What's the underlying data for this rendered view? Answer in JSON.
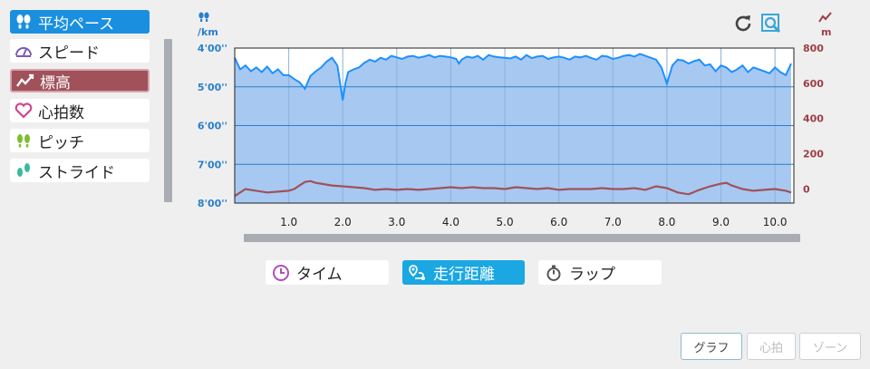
{
  "metrics": [
    {
      "label": "平均ペース",
      "icon": "footprints-icon",
      "state": "active"
    },
    {
      "label": "スピード",
      "icon": "speedometer-icon",
      "state": "normal"
    },
    {
      "label": "標高",
      "icon": "elevation-icon",
      "state": "active"
    },
    {
      "label": "心拍数",
      "icon": "heart-icon",
      "state": "normal"
    },
    {
      "label": "ピッチ",
      "icon": "pitch-icon",
      "state": "normal"
    },
    {
      "label": "ストライド",
      "icon": "stride-icon",
      "state": "normal"
    }
  ],
  "units": {
    "left": "/km",
    "right": "m"
  },
  "toolbar": {
    "reset_icon": "refresh-icon",
    "zoom_icon": "zoom-icon"
  },
  "xaxis_buttons": [
    {
      "label": "タイム",
      "icon": "clock-icon"
    },
    {
      "label": "走行距離",
      "icon": "route-icon"
    },
    {
      "label": "ラップ",
      "icon": "stopwatch-icon"
    }
  ],
  "bottom_buttons": [
    {
      "label": "グラフ",
      "enabled": true
    },
    {
      "label": "心拍",
      "enabled": false
    },
    {
      "label": "ゾーン",
      "enabled": false
    }
  ],
  "colors": {
    "pace": "#1e90ff",
    "pace_fill": "#a7c9f1",
    "elevation": "#a0515a",
    "active_tab": "#1aa7e2"
  },
  "chart_data": {
    "type": "area",
    "x_unit": "km",
    "x_ticks": [
      "1.0",
      "2.0",
      "3.0",
      "4.0",
      "5.0",
      "6.0",
      "7.0",
      "8.0",
      "9.0",
      "10.0"
    ],
    "xlim": [
      0,
      10.35
    ],
    "pace_ticks": [
      "4'00''",
      "5'00''",
      "6'00''",
      "7'00''",
      "8'00''"
    ],
    "pace_ylim_minutes": [
      4.0,
      8.0
    ],
    "elevation_ticks": [
      "800",
      "600",
      "400",
      "200",
      "0"
    ],
    "elevation_ylim": [
      -80,
      800
    ],
    "grid": true,
    "series": [
      {
        "metric": "pace",
        "x": [
          0,
          0.1,
          0.2,
          0.3,
          0.4,
          0.5,
          0.6,
          0.7,
          0.8,
          0.9,
          1.0,
          1.1,
          1.2,
          1.3,
          1.4,
          1.5,
          1.6,
          1.7,
          1.8,
          1.9,
          2.0,
          2.05,
          2.1,
          2.2,
          2.3,
          2.4,
          2.5,
          2.6,
          2.7,
          2.8,
          2.9,
          3.0,
          3.1,
          3.2,
          3.3,
          3.4,
          3.5,
          3.6,
          3.7,
          3.8,
          3.9,
          4.0,
          4.1,
          4.15,
          4.2,
          4.3,
          4.4,
          4.5,
          4.6,
          4.7,
          4.8,
          4.9,
          5.0,
          5.1,
          5.2,
          5.3,
          5.4,
          5.5,
          5.6,
          5.7,
          5.8,
          5.9,
          6.0,
          6.1,
          6.2,
          6.3,
          6.4,
          6.5,
          6.6,
          6.7,
          6.8,
          6.9,
          7.0,
          7.1,
          7.2,
          7.3,
          7.4,
          7.5,
          7.6,
          7.7,
          7.8,
          7.9,
          8.0,
          8.1,
          8.2,
          8.3,
          8.4,
          8.5,
          8.6,
          8.7,
          8.8,
          8.9,
          9.0,
          9.1,
          9.2,
          9.3,
          9.4,
          9.5,
          9.6,
          9.7,
          9.8,
          9.9,
          10.0,
          10.1,
          10.2,
          10.3
        ],
        "y": [
          4.25,
          4.55,
          4.45,
          4.6,
          4.5,
          4.62,
          4.48,
          4.65,
          4.55,
          4.7,
          4.7,
          4.8,
          4.88,
          5.05,
          4.72,
          4.6,
          4.5,
          4.35,
          4.25,
          4.45,
          5.35,
          4.9,
          4.62,
          4.55,
          4.5,
          4.38,
          4.3,
          4.35,
          4.25,
          4.3,
          4.2,
          4.24,
          4.28,
          4.22,
          4.2,
          4.25,
          4.22,
          4.18,
          4.24,
          4.2,
          4.22,
          4.24,
          4.28,
          4.4,
          4.3,
          4.22,
          4.25,
          4.2,
          4.3,
          4.18,
          4.22,
          4.24,
          4.25,
          4.27,
          4.22,
          4.3,
          4.18,
          4.26,
          4.22,
          4.2,
          4.28,
          4.24,
          4.22,
          4.25,
          4.3,
          4.22,
          4.24,
          4.2,
          4.26,
          4.3,
          4.2,
          4.22,
          4.28,
          4.25,
          4.2,
          4.18,
          4.22,
          4.15,
          4.2,
          4.25,
          4.3,
          4.5,
          4.92,
          4.45,
          4.3,
          4.32,
          4.4,
          4.34,
          4.3,
          4.45,
          4.42,
          4.6,
          4.45,
          4.5,
          4.62,
          4.55,
          4.45,
          4.62,
          4.5,
          4.55,
          4.6,
          4.65,
          4.5,
          4.62,
          4.7,
          4.4
        ]
      },
      {
        "metric": "elevation",
        "x": [
          0,
          0.2,
          0.4,
          0.6,
          0.8,
          1.0,
          1.1,
          1.2,
          1.3,
          1.4,
          1.5,
          1.6,
          1.8,
          2.0,
          2.2,
          2.4,
          2.6,
          2.8,
          3.0,
          3.2,
          3.4,
          3.6,
          3.8,
          4.0,
          4.2,
          4.4,
          4.6,
          4.8,
          5.0,
          5.2,
          5.4,
          5.6,
          5.8,
          6.0,
          6.2,
          6.4,
          6.6,
          6.8,
          7.0,
          7.2,
          7.4,
          7.6,
          7.8,
          8.0,
          8.2,
          8.4,
          8.6,
          8.8,
          9.0,
          9.1,
          9.2,
          9.4,
          9.6,
          9.8,
          10.0,
          10.2,
          10.3
        ],
        "y": [
          -40,
          0,
          -10,
          -20,
          -15,
          -10,
          0,
          20,
          40,
          45,
          35,
          30,
          20,
          15,
          10,
          5,
          -5,
          0,
          -5,
          0,
          -5,
          0,
          5,
          10,
          5,
          10,
          5,
          5,
          0,
          10,
          5,
          0,
          5,
          -5,
          0,
          0,
          0,
          5,
          0,
          0,
          5,
          -5,
          15,
          5,
          -20,
          -30,
          -5,
          15,
          30,
          35,
          20,
          0,
          -10,
          -5,
          0,
          -10,
          -20
        ]
      }
    ]
  }
}
